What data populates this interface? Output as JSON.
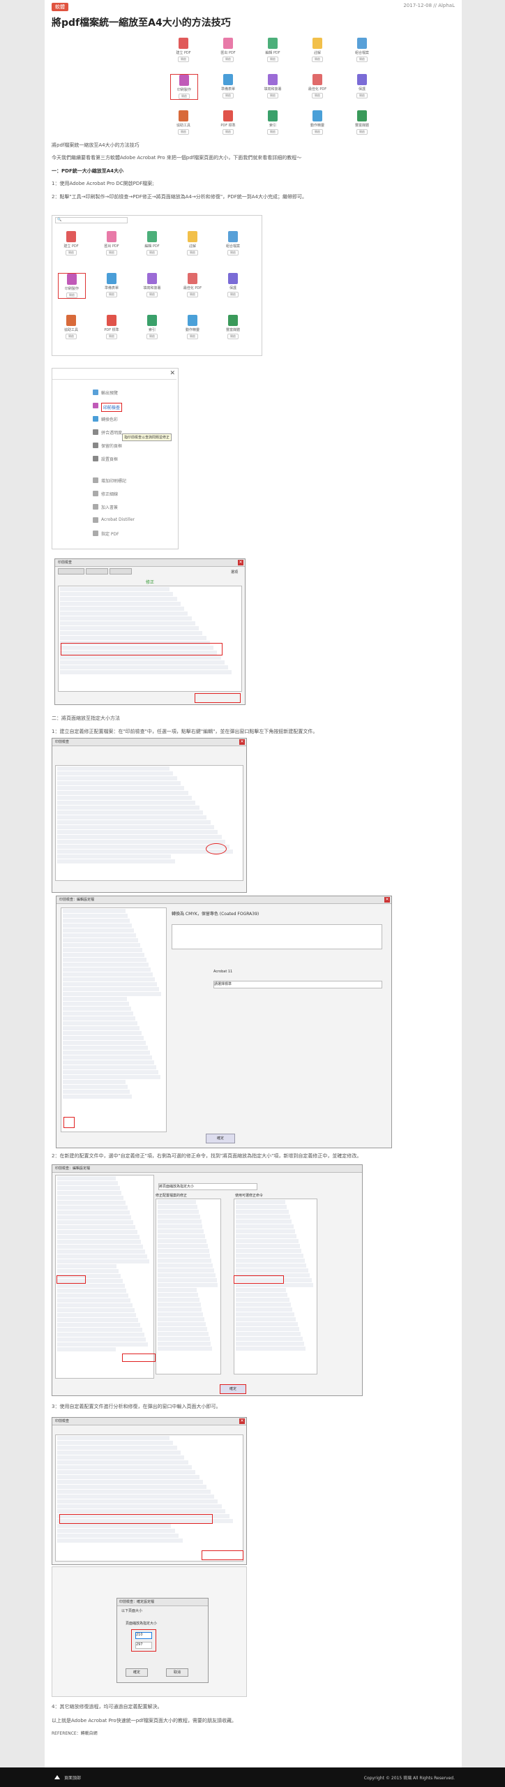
{
  "meta": {
    "tag": "軟體",
    "date": "2017-12-08 // AlphaL"
  },
  "article": {
    "title": "將pdf檔案統一縮放至A4大小的方法技巧",
    "intro": "將pdf檔案統一縮放至A4大小的方法技巧",
    "lead": "今天我們繼續要看看第三方軟體Adobe Acrobat Pro 來把一個pdf檔案頁面的大小，下面我們就來看看詳細的教程～",
    "section1": "一：PDF統一大小縮放至A4大小",
    "step1": "1：使用Adobe Acrobat Pro DC開啟PDF檔案;",
    "step2": "2：點擊\"工具→印刷製作→印前檢查→PDF修正→將頁面縮放為A4→分析和修復\"，PDF統一到A4大小完成；繼帶即可。",
    "section2": "二：將頁面縮放至指定大小方法",
    "s2step1": "1：建立自定義修正配置檔案：在\"印前檢查\"中，任選一項，點擊右鍵\"編輯\"，並在彈出窗口點擊左下角按鈕新建配置文件。",
    "s2step2": "2：在新建的配置文件中，選中\"自定義修正\"項，右側為可選的修正命令，找到\"將頁面縮放為指定大小\"項，新增到自定義修正中，並確定修改。",
    "s2step3": "3：使用自定義配置文件進行分析和修復，在彈出的窗口中輸入頁面大小即可。",
    "s2step4": "4：其它縮放修復過程，均可通過自定義配置解決。",
    "outro": "以上就是Adobe Acrobat Pro快速統一pdf檔案頁面大小的教程，需要的朋友請收藏。",
    "reference": "REFERENCE：轉載自網"
  },
  "tools": [
    {
      "label": "建立 PDF",
      "btn": "開啟",
      "color": "#e05a5a"
    },
    {
      "label": "匯出 PDF",
      "btn": "開啟",
      "color": "#e87aa8"
    },
    {
      "label": "編輯 PDF",
      "btn": "開啟",
      "color": "#4caf7a"
    },
    {
      "label": "註解",
      "btn": "開啟",
      "color": "#f2c04a"
    },
    {
      "label": "組合檔案",
      "btn": "開啟",
      "color": "#58a0d8"
    },
    {
      "label": "印刷製作",
      "btn": "開啟",
      "color": "#c05ab8"
    },
    {
      "label": "準備表單",
      "btn": "開啟",
      "color": "#4a9ed8"
    },
    {
      "label": "填寫和簽署",
      "btn": "開啟",
      "color": "#9b6bd6"
    },
    {
      "label": "最佳化 PDF",
      "btn": "開啟",
      "color": "#e06a6a"
    },
    {
      "label": "保護",
      "btn": "開啟",
      "color": "#7a6bd6"
    },
    {
      "label": "協助工具",
      "btn": "開啟",
      "color": "#d86a3a"
    },
    {
      "label": "PDF 標準",
      "btn": "開啟",
      "color": "#e0534a"
    },
    {
      "label": "索引",
      "btn": "開啟",
      "color": "#3aa06a"
    },
    {
      "label": "動作精靈",
      "btn": "開啟",
      "color": "#4aa0d8"
    },
    {
      "label": "豐富媒體",
      "btn": "開啟",
      "color": "#3a9a5a"
    }
  ],
  "printMenu": {
    "items": [
      "輸出預覽",
      "印前檢查",
      "轉換色彩",
      "拼合透明度",
      "保留的頁框",
      "設置頁框",
      "增加印刷標記",
      "修正細線",
      "加入書簽",
      "Acrobat Distiller",
      "指定 PDF"
    ],
    "tooltip": "指印前檢查以查詢問題並修正"
  },
  "preflightDialog": {
    "title": "印前檢查",
    "tabs": [
      "設定檔",
      "結果",
      "標準"
    ],
    "options": "選項",
    "profileLabel": "PDF 修正",
    "fix": "修正",
    "highlightedItem": "將頁面縮放為A4"
  },
  "editDialog": {
    "title": "印前檢查：編輯設定檔",
    "profileName": "轉換為 CMYK，保留專色 (Coated FOGRA39)",
    "createdWith": "Acrobat 11",
    "category": "請選擇標準",
    "ok": "確定"
  },
  "customFixDialog": {
    "title": "印前檢查：編輯設定檔",
    "left": "修正配置檔案的修正",
    "right": "使用可選修正命令",
    "nameValue": "將頁面縮放為指定大小",
    "highlighted": "將頁面縮放為指定大小",
    "ok": "確定"
  },
  "sizeDialog": {
    "title": "印前檢查：確定設定檔",
    "prompt": "以下頁面大小",
    "label": "頁面縮放為指定大小",
    "width": "210",
    "height": "297",
    "ok": "確定",
    "cancel": "取消"
  },
  "footer": {
    "left": "頁面頂部",
    "right": "Copyright © 2015 琉璃 All Rights Reserved."
  },
  "colors": {
    "accent": "#e0533f",
    "highlight": "#e02020",
    "selection": "#2f6ad0"
  }
}
